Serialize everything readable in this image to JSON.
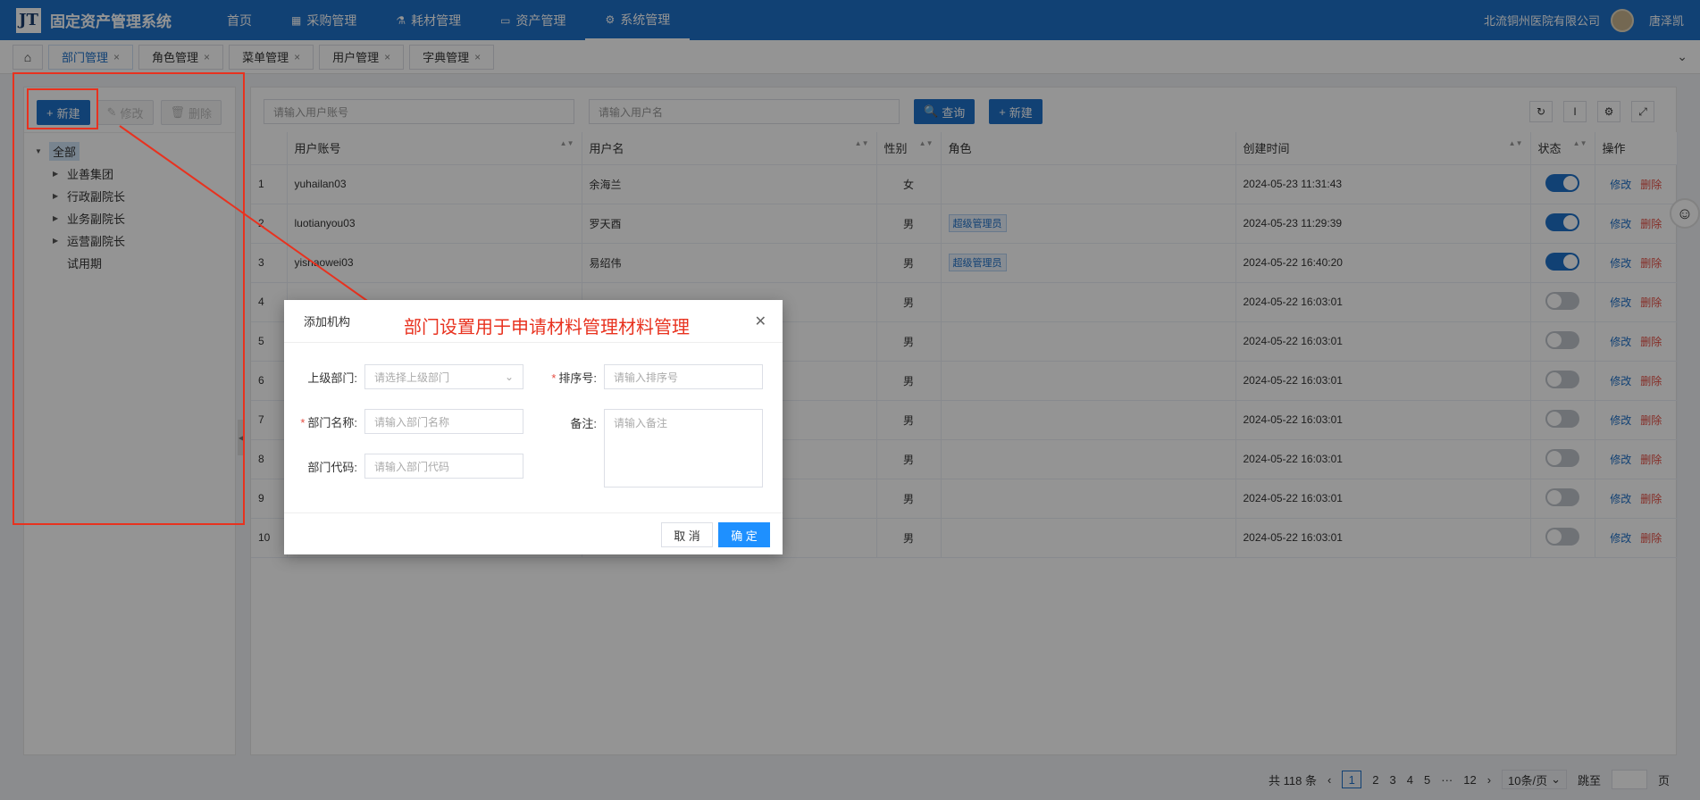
{
  "header": {
    "logo": "JT",
    "app_title": "固定资产管理系统",
    "nav": [
      {
        "label": "首页",
        "icon": ""
      },
      {
        "label": "采购管理",
        "icon": "grid-icon"
      },
      {
        "label": "耗材管理",
        "icon": "flask-icon"
      },
      {
        "label": "资产管理",
        "icon": "calendar-icon"
      },
      {
        "label": "系统管理",
        "icon": "gear-icon"
      }
    ],
    "company": "北流铜州医院有限公司",
    "user_name": "唐泽凯"
  },
  "tabs": [
    {
      "label": "部门管理",
      "active": true
    },
    {
      "label": "角色管理"
    },
    {
      "label": "菜单管理"
    },
    {
      "label": "用户管理"
    },
    {
      "label": "字典管理"
    }
  ],
  "left_toolbar": {
    "new": "新建",
    "edit": "修改",
    "delete": "删除"
  },
  "tree": {
    "root": "全部",
    "children": [
      "业善集团",
      "行政副院长",
      "业务副院长",
      "运营副院长"
    ],
    "leaf": "试用期"
  },
  "search": {
    "account_placeholder": "请输入用户账号",
    "name_placeholder": "请输入用户名",
    "query": "查询",
    "new": "新建"
  },
  "columns": [
    "用户账号",
    "用户名",
    "性别",
    "角色",
    "创建时间",
    "状态",
    "操作"
  ],
  "rows": [
    {
      "no": "1",
      "account": "yuhailan03",
      "name": "余海兰",
      "gender": "女",
      "role": "",
      "created": "2024-05-23 11:31:43",
      "on": true
    },
    {
      "no": "2",
      "account": "luotianyou03",
      "name": "罗天酉",
      "gender": "男",
      "role": "超级管理员",
      "created": "2024-05-23 11:29:39",
      "on": true
    },
    {
      "no": "3",
      "account": "yishaowei03",
      "name": "易绍伟",
      "gender": "男",
      "role": "超级管理员",
      "created": "2024-05-22 16:40:20",
      "on": true
    },
    {
      "no": "4",
      "account": "",
      "name": "",
      "gender": "男",
      "role": "",
      "created": "2024-05-22 16:03:01",
      "on": false
    },
    {
      "no": "5",
      "account": "",
      "name": "",
      "gender": "男",
      "role": "",
      "created": "2024-05-22 16:03:01",
      "on": false
    },
    {
      "no": "6",
      "account": "",
      "name": "",
      "gender": "男",
      "role": "",
      "created": "2024-05-22 16:03:01",
      "on": false
    },
    {
      "no": "7",
      "account": "",
      "name": "",
      "gender": "男",
      "role": "",
      "created": "2024-05-22 16:03:01",
      "on": false
    },
    {
      "no": "8",
      "account": "",
      "name": "",
      "gender": "男",
      "role": "",
      "created": "2024-05-22 16:03:01",
      "on": false
    },
    {
      "no": "9",
      "account": "",
      "name": "",
      "gender": "男",
      "role": "",
      "created": "2024-05-22 16:03:01",
      "on": false
    },
    {
      "no": "10",
      "account": "",
      "name": "",
      "gender": "男",
      "role": "",
      "created": "2024-05-22 16:03:01",
      "on": false
    }
  ],
  "ops": {
    "edit": "修改",
    "delete": "删除"
  },
  "pagination": {
    "total": "共 118 条",
    "pages": [
      "1",
      "2",
      "3",
      "4",
      "5",
      "···",
      "12"
    ],
    "page_size": "10条/页",
    "goto": "跳至",
    "page_unit": "页"
  },
  "modal": {
    "title": "添加机构",
    "parent_label": "上级部门:",
    "parent_placeholder": "请选择上级部门",
    "sort_label": "排序号:",
    "sort_placeholder": "请输入排序号",
    "name_label": "部门名称:",
    "name_placeholder": "请输入部门名称",
    "remark_label": "备注:",
    "remark_placeholder": "请输入备注",
    "code_label": "部门代码:",
    "code_placeholder": "请输入部门代码",
    "cancel": "取 消",
    "ok": "确 定"
  },
  "annotation": {
    "text": "部门设置用于申请材料管理材料管理",
    "color": "#e8321f"
  }
}
